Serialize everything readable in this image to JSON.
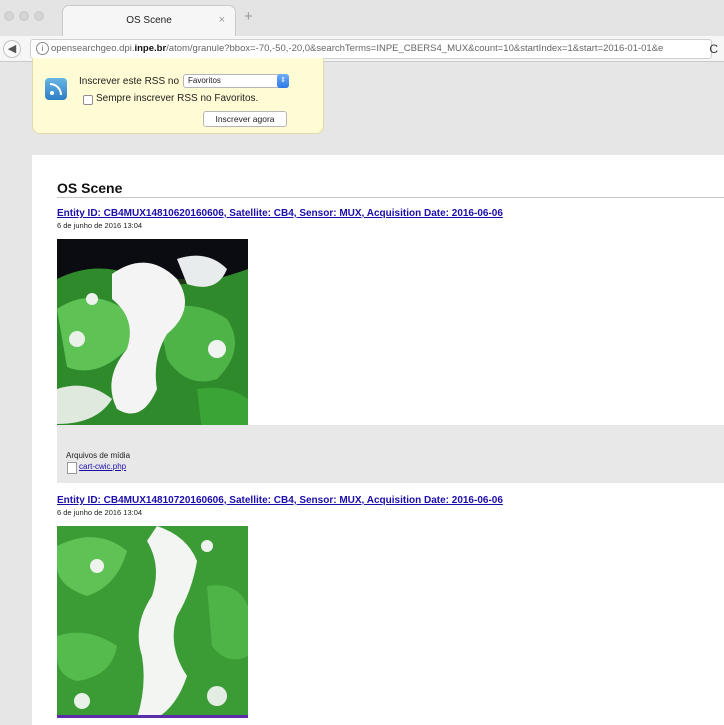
{
  "browser": {
    "tab_title": "OS Scene",
    "tab_close": "×",
    "new_tab": "+",
    "back": "◀",
    "info": "i",
    "url_prefix": "opensearchgeo.dpi.",
    "url_domain": "inpe.br",
    "url_path": "/atom/granule?bbox=-70,-50,-20,0&searchTerms=INPE_CBERS4_MUX&count=10&startIndex=1&start=2016-01-01&e",
    "reload": "C"
  },
  "rss": {
    "subscribe_label": "Inscrever este RSS no",
    "reader_selected": "Favoritos",
    "always_label": "Sempre inscrever RSS no Favoritos.",
    "subscribe_button": "Inscrever agora",
    "icon": "rss-feed-icon"
  },
  "feed": {
    "title": "OS Scene",
    "entries": [
      {
        "title": "Entity ID: CB4MUX14810620160606, Satellite: CB4, Sensor: MUX, Acquisition Date: 2016-06-06",
        "date": "6 de junho de 2016 13:04"
      },
      {
        "title": "Entity ID: CB4MUX14810720160606, Satellite: CB4, Sensor: MUX, Acquisition Date: 2016-06-06",
        "date": "6 de junho de 2016 13:04"
      }
    ],
    "media": {
      "label": "Arquivos de mídia",
      "file": "cart-cwic.php"
    }
  },
  "colors": {
    "link": "#1a0dab",
    "rss_background": "#fffbd4"
  }
}
